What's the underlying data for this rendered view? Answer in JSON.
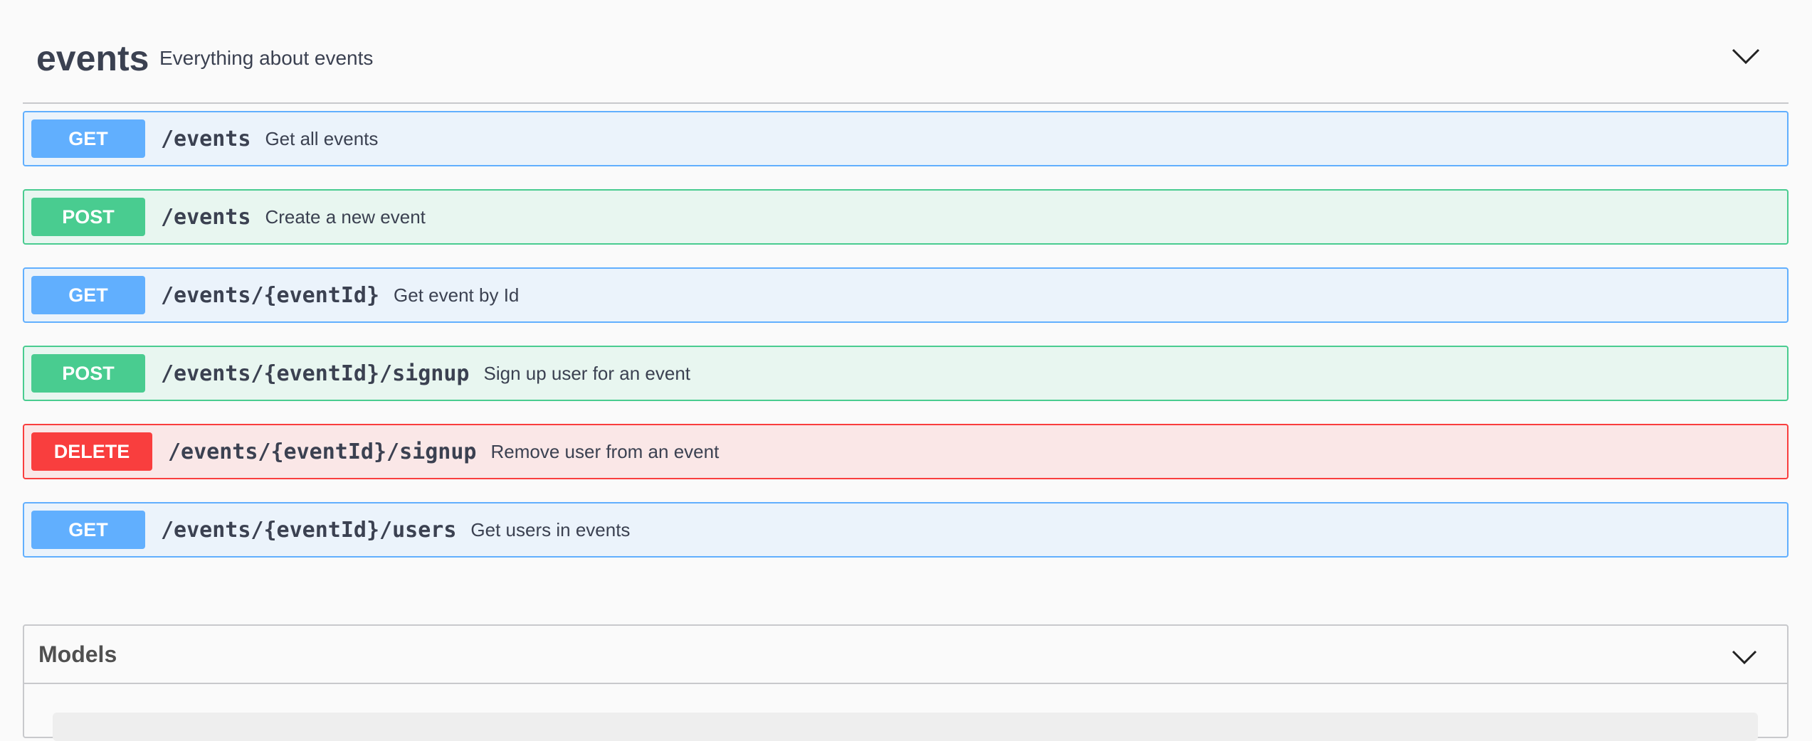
{
  "tag": {
    "name": "events",
    "description": "Everything about events"
  },
  "operations": [
    {
      "method": "GET",
      "path": "/events",
      "summary": "Get all events"
    },
    {
      "method": "POST",
      "path": "/events",
      "summary": "Create a new event"
    },
    {
      "method": "GET",
      "path": "/events/{eventId}",
      "summary": "Get event by Id"
    },
    {
      "method": "POST",
      "path": "/events/{eventId}/signup",
      "summary": "Sign up user for an event"
    },
    {
      "method": "DELETE",
      "path": "/events/{eventId}/signup",
      "summary": "Remove user from an event"
    },
    {
      "method": "GET",
      "path": "/events/{eventId}/users",
      "summary": "Get users in events"
    }
  ],
  "models": {
    "title": "Models"
  },
  "icons": {
    "tag_toggle": "chevron-down-icon",
    "models_toggle": "chevron-down-icon"
  },
  "colors": {
    "get": "#61affe",
    "post": "#49cc90",
    "delete": "#f93e3e",
    "text": "#3b4151"
  }
}
